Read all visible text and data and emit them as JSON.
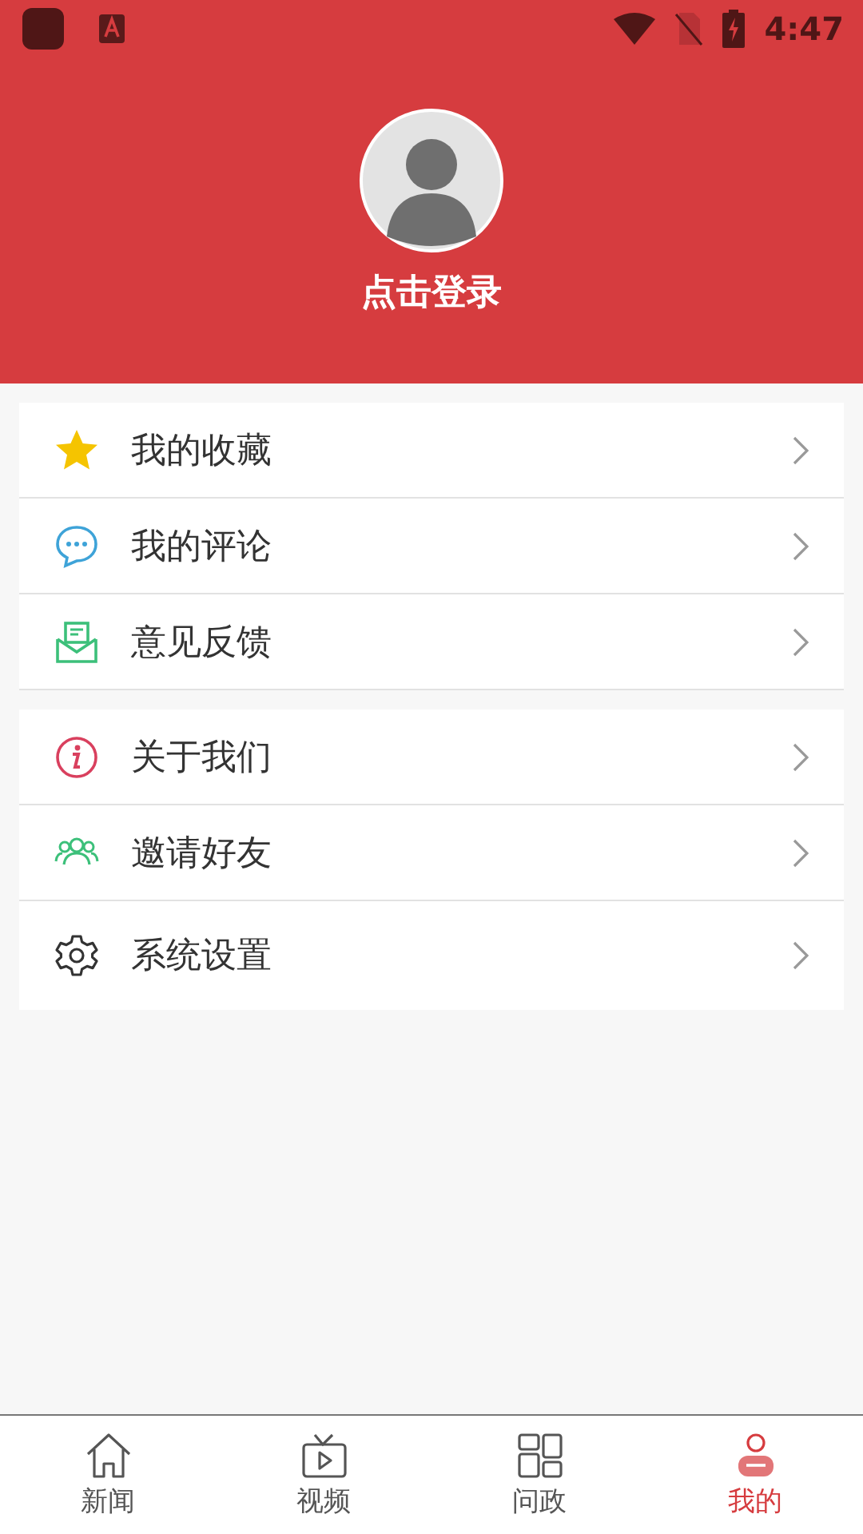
{
  "status_bar": {
    "time": "4:47"
  },
  "profile": {
    "login_label": "点击登录"
  },
  "menu_groups": [
    {
      "items": [
        {
          "label": "我的收藏"
        },
        {
          "label": "我的评论"
        },
        {
          "label": "意见反馈"
        }
      ]
    },
    {
      "items": [
        {
          "label": "关于我们"
        },
        {
          "label": "邀请好友"
        },
        {
          "label": "系统设置"
        }
      ]
    }
  ],
  "bottom_nav": [
    {
      "label": "新闻",
      "selected": false
    },
    {
      "label": "视频",
      "selected": false
    },
    {
      "label": "问政",
      "selected": false
    },
    {
      "label": "我的",
      "selected": true
    }
  ]
}
